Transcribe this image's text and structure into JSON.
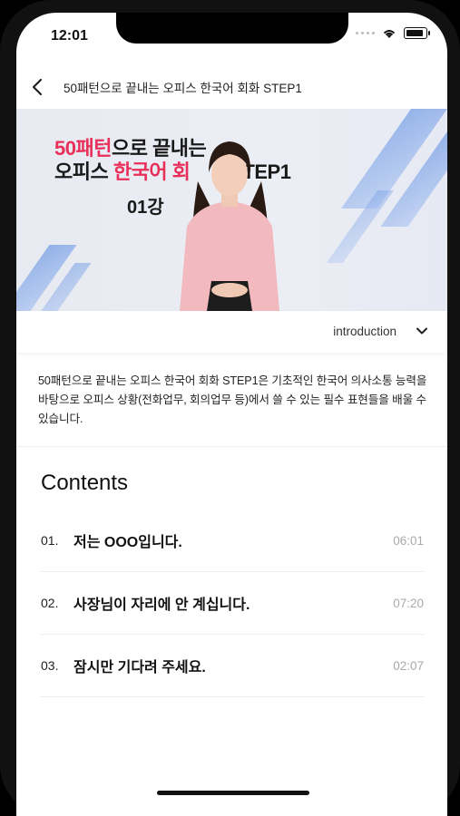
{
  "status": {
    "time": "12:01"
  },
  "nav": {
    "title": "50패턴으로 끝내는 오피스 한국어 회화 STEP1"
  },
  "video": {
    "line1_highlight": "50패턴",
    "line1_rest": "으로 끝내는",
    "line2_prefix": "오피스 ",
    "line2_highlight": "한국어 회",
    "line2_suffix": "TEP1",
    "lesson": "01강",
    "colors": {
      "highlight": "#e8305a",
      "stripe": "#7ea4e6"
    }
  },
  "intro": {
    "label": "introduction"
  },
  "description": "50패턴으로 끝내는 오피스 한국어 회화 STEP1은 기초적인 한국어 의사소통 능력을 바탕으로 오피스 상황(전화업무, 회의업무 등)에서 쓸 수 있는 필수 표현들을 배울 수 있습니다.",
  "contents": {
    "title": "Contents",
    "items": [
      {
        "num": "01.",
        "title": "저는 OOO입니다.",
        "time": "06:01"
      },
      {
        "num": "02.",
        "title": "사장님이 자리에 안 계십니다.",
        "time": "07:20"
      },
      {
        "num": "03.",
        "title": "잠시만 기다려 주세요.",
        "time": "02:07"
      }
    ]
  }
}
